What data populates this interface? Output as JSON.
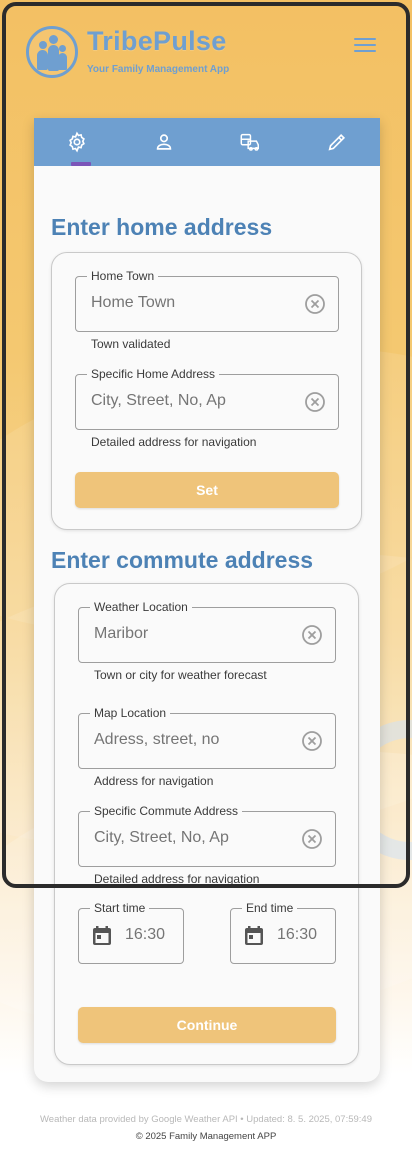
{
  "brand": {
    "title": "TribePulse",
    "subtitle": "Your Family Management App"
  },
  "tabs": [
    {
      "icon": "gear-icon",
      "active": true
    },
    {
      "icon": "person-icon",
      "active": false
    },
    {
      "icon": "commute-icon",
      "active": false
    },
    {
      "icon": "pencil-icon",
      "active": false
    }
  ],
  "home": {
    "title": "Enter home address",
    "town": {
      "label": "Home Town",
      "placeholder": "Home Town",
      "helper": "Town validated"
    },
    "address": {
      "label": "Specific Home Address",
      "placeholder": "City, Street, No, Ap",
      "helper": "Detailed address for navigation"
    },
    "set_label": "Set"
  },
  "commute": {
    "title": "Enter commute address",
    "weather": {
      "label": "Weather Location",
      "placeholder": "Maribor",
      "helper": "Town or city for weather forecast"
    },
    "map": {
      "label": "Map Location",
      "placeholder": "Adress, street, no",
      "helper": "Address for navigation"
    },
    "specific": {
      "label": "Specific Commute Address",
      "placeholder": "City, Street, No, Ap",
      "helper": "Detailed address for navigation"
    },
    "start": {
      "label": "Start time",
      "placeholder": "16:30"
    },
    "end": {
      "label": "End time",
      "placeholder": "16:30"
    },
    "continue_label": "Continue"
  },
  "footer": {
    "api": "Weather data provided by Google Weather API • Updated: 8. 5. 2025, 07:59:49",
    "copyright": "© 2025 Family Management APP"
  },
  "colors": {
    "accent_blue": "#6f9fd0",
    "title_blue": "#4d82b5",
    "button_gold": "#efc47a",
    "tab_indicator": "#7b55b8"
  }
}
